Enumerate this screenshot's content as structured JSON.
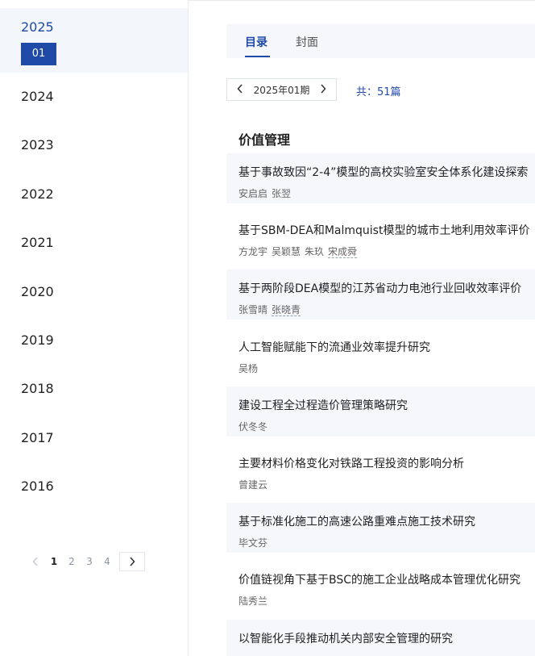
{
  "sidebar": {
    "active_year": "2025",
    "active_issue": "01",
    "years": [
      "2024",
      "2023",
      "2022",
      "2021",
      "2020",
      "2019",
      "2018",
      "2017",
      "2016"
    ],
    "pager": {
      "pages": [
        "1",
        "2",
        "3",
        "4"
      ],
      "current": "1",
      "prev_icon": "chevron-left-icon",
      "next_icon": "chevron-right-icon"
    }
  },
  "tabs": [
    "目录",
    "封面"
  ],
  "issue_selector": {
    "label": "2025年01期",
    "prev_icon": "chevron-left-icon",
    "next_icon": "chevron-right-icon"
  },
  "count": "共：51篇",
  "section_title": "价值管理",
  "articles": [
    {
      "title": "基于事故致因“2-4”模型的高校实验室安全体系化建设探索",
      "authors": [
        {
          "name": "安启启",
          "linked": false
        },
        {
          "name": "张翌",
          "linked": false
        }
      ]
    },
    {
      "title": "基于SBM-DEA和Malmquist模型的城市土地利用效率评价",
      "authors": [
        {
          "name": "方龙宇",
          "linked": false
        },
        {
          "name": "吴颖慧",
          "linked": false
        },
        {
          "name": "朱玖",
          "linked": false
        },
        {
          "name": "宋成舜",
          "linked": true
        }
      ]
    },
    {
      "title": "基于两阶段DEA模型的江苏省动力电池行业回收效率评价",
      "authors": [
        {
          "name": "张雪晴",
          "linked": false
        },
        {
          "name": "张晓青",
          "linked": true
        }
      ]
    },
    {
      "title": "人工智能赋能下的流通业效率提升研究",
      "authors": [
        {
          "name": "吴杨",
          "linked": false
        }
      ]
    },
    {
      "title": "建设工程全过程造价管理策略研究",
      "authors": [
        {
          "name": "伏冬冬",
          "linked": false
        }
      ]
    },
    {
      "title": "主要材料价格变化对铁路工程投资的影响分析",
      "authors": [
        {
          "name": "曾建云",
          "linked": false
        }
      ]
    },
    {
      "title": "基于标准化施工的高速公路重难点施工技术研究",
      "authors": [
        {
          "name": "毕文芬",
          "linked": false
        }
      ]
    },
    {
      "title": "价值链视角下基于BSC的施工企业战略成本管理优化研究",
      "authors": [
        {
          "name": "陆秀兰",
          "linked": false
        }
      ]
    },
    {
      "title": "以智能化手段推动机关内部安全管理的研究",
      "authors": []
    }
  ],
  "colors": {
    "accent": "#1f4aa8",
    "shade": "#f5f7fb"
  }
}
